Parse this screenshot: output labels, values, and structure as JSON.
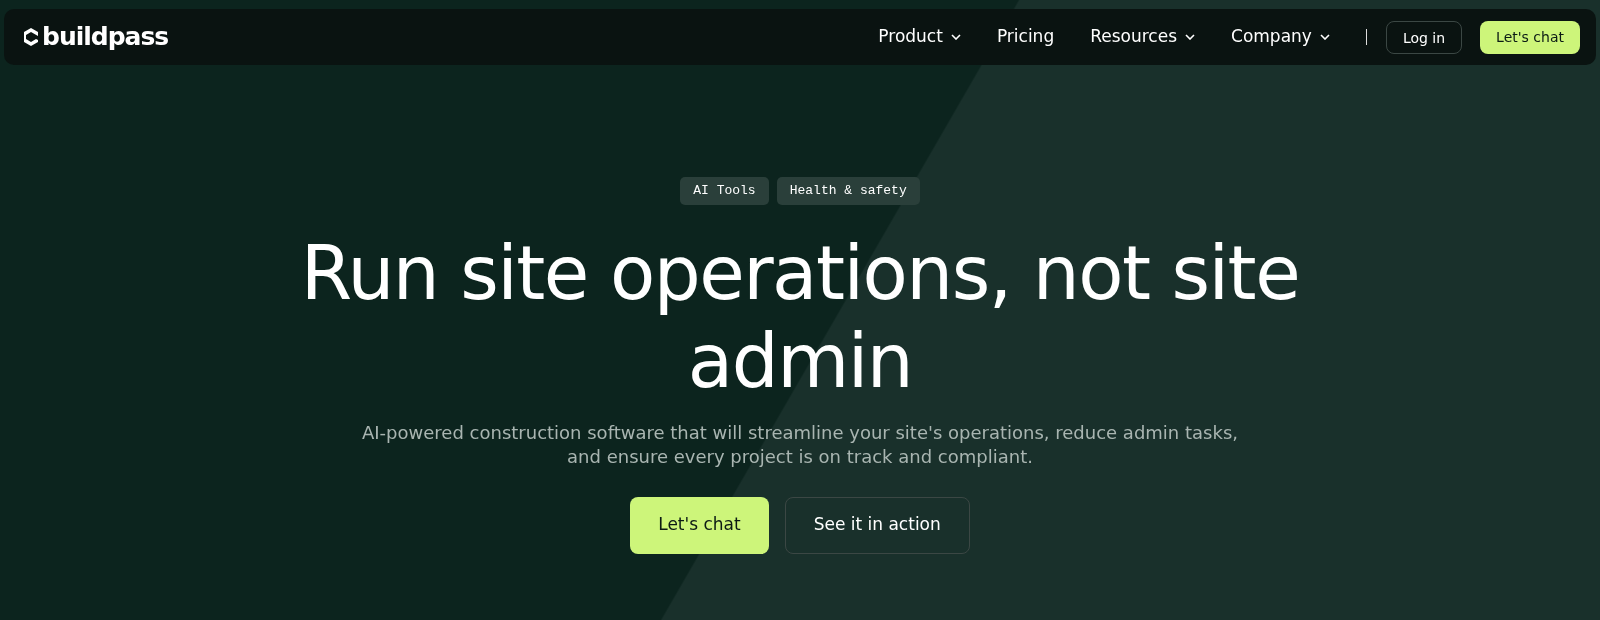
{
  "logo": {
    "text": "buildpass"
  },
  "nav": [
    {
      "label": "Product",
      "dropdown": true
    },
    {
      "label": "Pricing",
      "dropdown": false
    },
    {
      "label": "Resources",
      "dropdown": true
    },
    {
      "label": "Company",
      "dropdown": true
    }
  ],
  "nav_buttons": [
    {
      "label": "Log in",
      "kind": "outline"
    },
    {
      "label": "Let's chat",
      "kind": "primary"
    }
  ],
  "hero": {
    "tags": [
      "AI Tools",
      "Health & safety"
    ],
    "title": "Run site operations, not site admin",
    "subtitle": "AI-powered construction software that will streamline your site's operations, reduce admin tasks, and ensure every project is on track and compliant.",
    "buttons": [
      {
        "label": "Let's chat",
        "kind": "primary"
      },
      {
        "label": "See it in action",
        "kind": "outline"
      }
    ]
  }
}
